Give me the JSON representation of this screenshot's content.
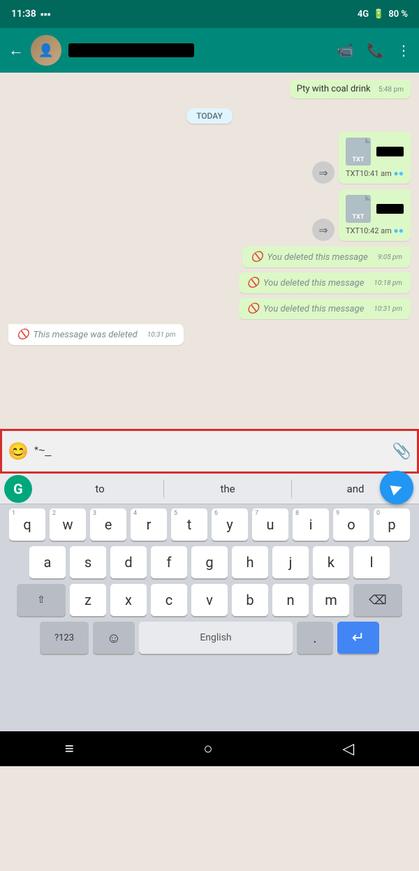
{
  "status_bar": {
    "time": "11:38",
    "signal": "4G",
    "battery": "80 %"
  },
  "header": {
    "back_label": "←",
    "contact_name_redacted": true,
    "video_icon": "📹",
    "phone_icon": "📞",
    "menu_icon": "⋮"
  },
  "chat": {
    "old_message": {
      "text": "Pty with coal drink",
      "time": "5:48 pm"
    },
    "date_divider": "TODAY",
    "file_messages": [
      {
        "type": "txt",
        "time": "10:41 am",
        "label": "TXT"
      },
      {
        "type": "txt",
        "time": "10:42 am",
        "label": "TXT"
      }
    ],
    "deleted_out": [
      {
        "text": "You deleted this message",
        "time": "9:05 pm"
      },
      {
        "text": "You deleted this message",
        "time": "10:18 pm"
      },
      {
        "text": "You deleted this message",
        "time": "10:31 pm"
      }
    ],
    "deleted_in": {
      "text": "This message was deleted",
      "time": "10:31 pm"
    }
  },
  "input_bar": {
    "emoji_icon": "😊",
    "text_value": "*~_",
    "attach_icon": "📎",
    "send_icon": "➤"
  },
  "keyboard": {
    "suggestions": [
      "to",
      "the",
      "and"
    ],
    "grammarly_letter": "G",
    "rows": [
      [
        "q",
        "w",
        "e",
        "r",
        "t",
        "y",
        "u",
        "i",
        "o",
        "p"
      ],
      [
        "a",
        "s",
        "d",
        "f",
        "g",
        "h",
        "j",
        "k",
        "l"
      ],
      [
        "z",
        "x",
        "c",
        "v",
        "b",
        "n",
        "m"
      ]
    ],
    "row_nums": [
      [
        "1",
        "2",
        "3",
        "4",
        "5",
        "6",
        "7",
        "8",
        "9",
        "0"
      ]
    ],
    "special_labels": {
      "shift": "⇧",
      "delete": "⌫",
      "num": "?123",
      "comma": ",",
      "emoji": "☺",
      "space": "English",
      "dot": ".",
      "enter": "↵"
    }
  },
  "nav_bar": {
    "menu_icon": "≡",
    "home_icon": "○",
    "back_icon": "◁"
  }
}
